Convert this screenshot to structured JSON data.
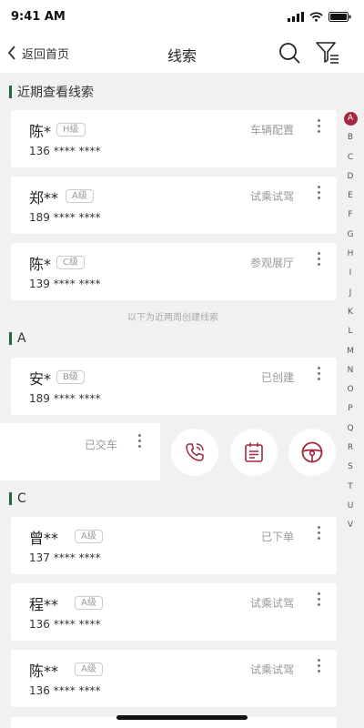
{
  "status_bar": {
    "time": "9:41 AM"
  },
  "nav": {
    "back_label": "返回首页",
    "title": "线索"
  },
  "recent": {
    "header": "近期查看线索",
    "cards": [
      {
        "name": "陈*",
        "grade": "H级",
        "phone": "136 **** ****",
        "status": "车辆配置"
      },
      {
        "name": "郑**",
        "grade": "A级",
        "phone": "189 **** ****",
        "status": "试乘试驾"
      },
      {
        "name": "陈*",
        "grade": "C级",
        "phone": "139 **** ****",
        "status": "参观展厅"
      }
    ],
    "footer_note": "以下为近两周创建线索"
  },
  "section_a": {
    "header": "A",
    "cards": [
      {
        "name": "安*",
        "grade": "B级",
        "phone": "189 **** ****",
        "status": "已创建"
      }
    ],
    "swiped": {
      "status": "已交车"
    }
  },
  "actions": [
    {
      "icon": "phone-call-icon"
    },
    {
      "icon": "calendar-note-icon"
    },
    {
      "icon": "steering-wheel-icon"
    }
  ],
  "section_c": {
    "header": "C",
    "cards": [
      {
        "name": "曾**",
        "grade": "A级",
        "phone": "137 **** ****",
        "status": "已下单"
      },
      {
        "name": "程**",
        "grade": "A级",
        "phone": "136 **** ****",
        "status": "试乘试驾"
      },
      {
        "name": "陈**",
        "grade": "A级",
        "phone": "136 **** ****",
        "status": "试乘试驾"
      }
    ]
  },
  "index_bar": [
    "A",
    "B",
    "C",
    "D",
    "E",
    "F",
    "G",
    "H",
    "I",
    "J",
    "K",
    "L",
    "M",
    "N",
    "O",
    "P",
    "Q",
    "R",
    "S",
    "T",
    "U",
    "V"
  ],
  "colors": {
    "accent": "#a3273c",
    "section_bar": "#1f6b3d",
    "background": "#f1f1f1"
  }
}
